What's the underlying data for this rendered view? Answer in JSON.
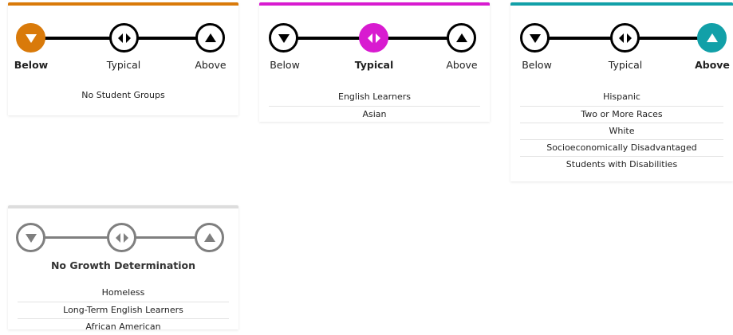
{
  "colors": {
    "below": "#d97a0a",
    "typical": "#d81bd0",
    "above": "#12a0a8",
    "none": "#dddddd",
    "none_icon": "#7f7f7f"
  },
  "cards": {
    "below": {
      "labels": {
        "below": "Below",
        "typical": "Typical",
        "above": "Above"
      },
      "empty_text": "No Student Groups",
      "groups": []
    },
    "typical": {
      "labels": {
        "below": "Below",
        "typical": "Typical",
        "above": "Above"
      },
      "groups": [
        "English Learners",
        "Asian"
      ]
    },
    "above": {
      "labels": {
        "below": "Below",
        "typical": "Typical",
        "above": "Above"
      },
      "groups": [
        "Hispanic",
        "Two or More Races",
        "White",
        "Socioeconomically Disadvantaged",
        "Students with Disabilities"
      ]
    },
    "no_growth": {
      "title": "No Growth Determination",
      "groups": [
        "Homeless",
        "Long-Term English Learners",
        "African American"
      ]
    }
  }
}
